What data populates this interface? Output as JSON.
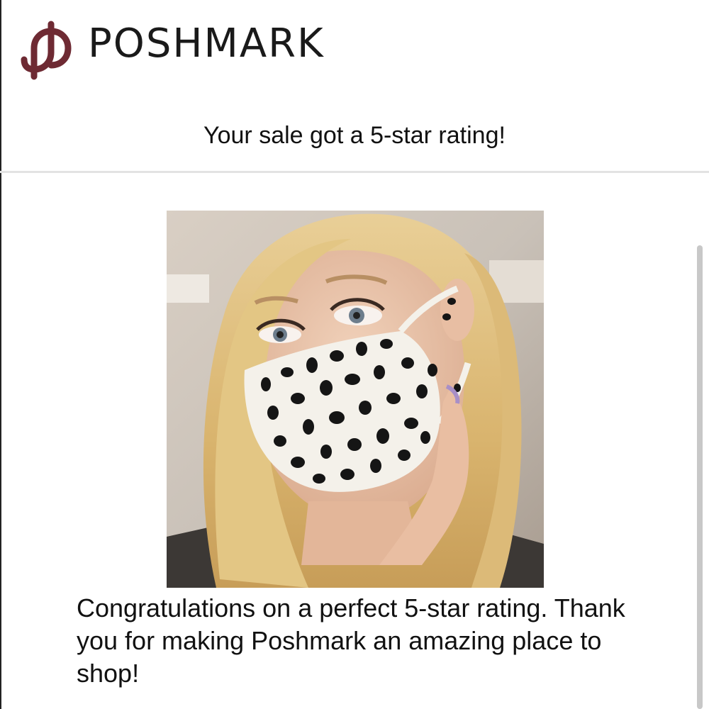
{
  "brand": {
    "name": "POSHMARK",
    "logo_icon": "poshmark-logo-icon",
    "color": "#6e2a33"
  },
  "email": {
    "subject_heading": "Your sale got a 5-star rating!",
    "message": "Congratulations on a perfect 5-star rating. Thank you for making Poshmark an amazing place to shop!",
    "image_alt_description_icon": "product-photo"
  }
}
